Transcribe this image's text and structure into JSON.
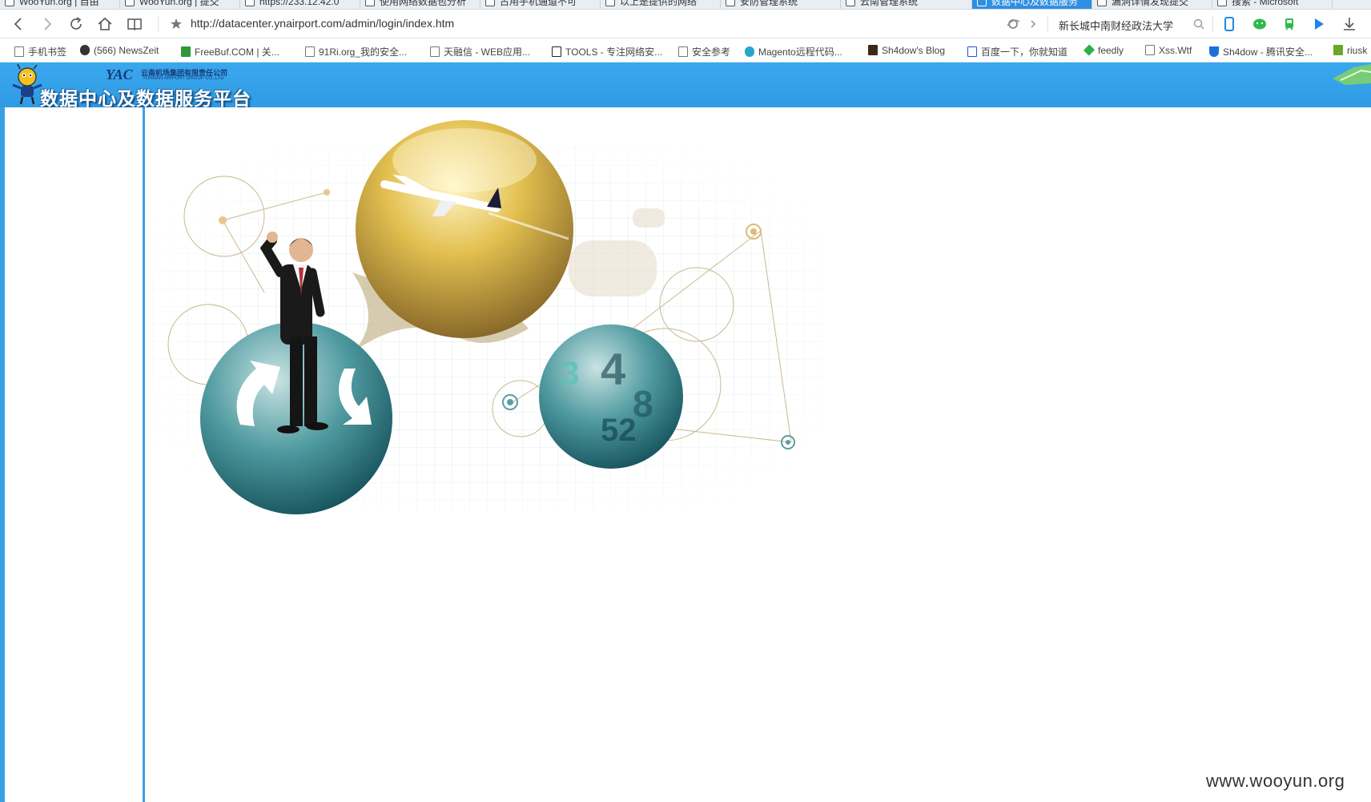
{
  "tabs": [
    {
      "label": "WooYun.org | 自由"
    },
    {
      "label": "WooYun.org | 提交"
    },
    {
      "label": "https://233.12.42.0"
    },
    {
      "label": "使用网络数据包分析"
    },
    {
      "label": "占用手机通道不可"
    },
    {
      "label": "以上是提供的网络"
    },
    {
      "label": "安防管理系统"
    },
    {
      "label": "云南管理系统"
    },
    {
      "label": "数据中心及数据服务"
    },
    {
      "label": "漏洞详情发现提交"
    },
    {
      "label": "搜索 - Microsoft"
    }
  ],
  "nav": {
    "url": "http://datacenter.ynairport.com/admin/login/index.htm",
    "search_text": "新长城中南财经政法大学"
  },
  "bookmarks": [
    {
      "label": "手机书签"
    },
    {
      "label": "(566) NewsZeit"
    },
    {
      "label": "FreeBuf.COM | 关..."
    },
    {
      "label": "91Ri.org_我的安全..."
    },
    {
      "label": "天融信 - WEB应用..."
    },
    {
      "label": "TOOLS - 专注网络安..."
    },
    {
      "label": "安全参考"
    },
    {
      "label": "Magento远程代码..."
    },
    {
      "label": "Sh4dow's Blog"
    },
    {
      "label": "百度一下，你就知道"
    },
    {
      "label": "feedly"
    },
    {
      "label": "Xss.Wtf"
    },
    {
      "label": "Sh4dow - 腾讯安全..."
    },
    {
      "label": "riusk"
    }
  ],
  "site": {
    "title": "数据中心及数据服务平台",
    "logo_mark": "YAC",
    "company_cn": "云南机场集团有限责任公司",
    "company_en": "YUNNAN AIRPORT GROUP CO.,LTD"
  },
  "watermark": "www.wooyun.org",
  "colors": {
    "header_blue": "#2f9be4",
    "frame_blue": "#3aa0e6",
    "gold": "#d9b54a",
    "teal": "#2f7d86"
  }
}
